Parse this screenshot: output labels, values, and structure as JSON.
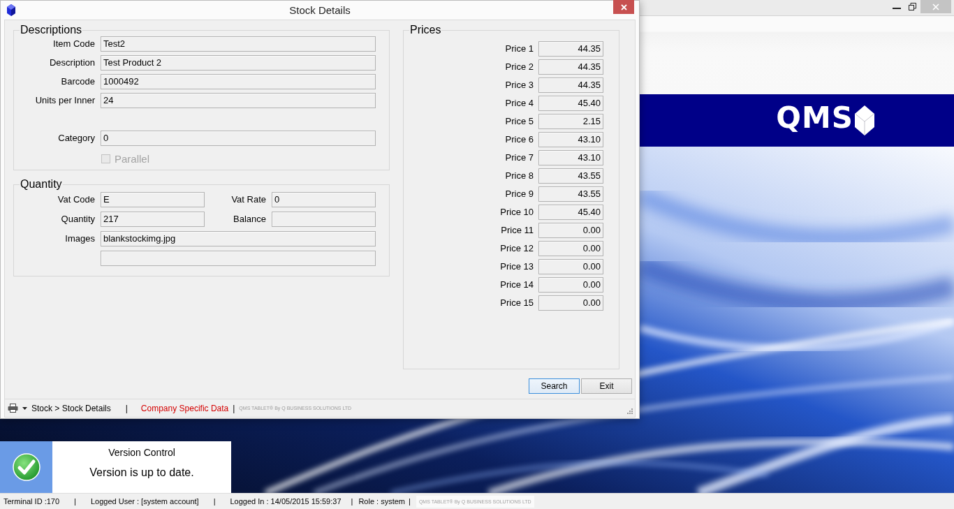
{
  "main_window": {
    "logo": {
      "text": "QMS"
    }
  },
  "dialog": {
    "title": "Stock Details",
    "descriptions": {
      "title": "Descriptions",
      "fields": [
        {
          "label": "Item Code",
          "value": "Test2"
        },
        {
          "label": "Description",
          "value": "Test Product 2"
        },
        {
          "label": "Barcode",
          "value": "1000492"
        },
        {
          "label": "Units per Inner",
          "value": "24"
        }
      ],
      "category": {
        "label": "Category",
        "value": "0"
      },
      "parallel": {
        "label": "Parallel",
        "checked": false,
        "disabled": true
      }
    },
    "quantity": {
      "title": "Quantity",
      "rows": [
        {
          "fields": [
            {
              "label": "Vat Code",
              "value": "E"
            },
            {
              "label": "Vat Rate",
              "value": "0"
            }
          ]
        },
        {
          "fields": [
            {
              "label": "Quantity",
              "value": "217"
            },
            {
              "label": "Balance"
            }
          ]
        }
      ],
      "images": {
        "label": "Images",
        "value": "blankstockimg.jpg"
      }
    },
    "prices": {
      "title": "Prices",
      "rows": [
        {
          "label": "Price 1",
          "value": "44.35"
        },
        {
          "label": "Price 2",
          "value": "44.35"
        },
        {
          "label": "Price 3",
          "value": "44.35"
        },
        {
          "label": "Price 4",
          "value": "45.40"
        },
        {
          "label": "Price 5",
          "value": "2.15"
        },
        {
          "label": "Price 6",
          "value": "43.10"
        },
        {
          "label": "Price 7",
          "value": "43.10"
        },
        {
          "label": "Price 8",
          "value": "43.55"
        },
        {
          "label": "Price 9",
          "value": "43.55"
        },
        {
          "label": "Price 10",
          "value": "45.40"
        },
        {
          "label": "Price 11",
          "value": "0.00"
        },
        {
          "label": "Price 12",
          "value": "0.00"
        },
        {
          "label": "Price 13",
          "value": "0.00"
        },
        {
          "label": "Price 14",
          "value": "0.00"
        },
        {
          "label": "Price 15",
          "value": "0.00"
        }
      ]
    },
    "buttons": [
      {
        "label": "Search",
        "focused": true
      },
      {
        "label": "Exit",
        "focused": false
      }
    ],
    "status_strip": {
      "items": [
        {
          "kind": "breadcrumb",
          "text": "Stock > Stock Details"
        },
        {
          "kind": "separator",
          "text": "|"
        },
        {
          "kind": "highlight",
          "text": "Company Specific Data"
        },
        {
          "kind": "separator",
          "text": "|"
        },
        {
          "kind": "credit",
          "text": "QMS TABLET® By Q BUSINESS SOLUTIONS LTD"
        }
      ]
    }
  },
  "notification": {
    "title": "Version Control",
    "message": "Version is up to date."
  },
  "status_bar": {
    "items": [
      {
        "kind": "text",
        "text": "Terminal ID :170"
      },
      {
        "kind": "separator",
        "text": "|"
      },
      {
        "kind": "text",
        "text": "Logged User : [system account]"
      },
      {
        "kind": "separator",
        "text": "|"
      },
      {
        "kind": "text",
        "text": "Logged In : 14/05/2015 15:59:37"
      },
      {
        "kind": "separator",
        "text": "|"
      },
      {
        "kind": "text",
        "text": "Role : system"
      },
      {
        "kind": "separator",
        "text": "|"
      },
      {
        "kind": "credit",
        "text": "QMS TABLET® By Q BUSINESS SOLUTIONS LTD"
      }
    ]
  }
}
